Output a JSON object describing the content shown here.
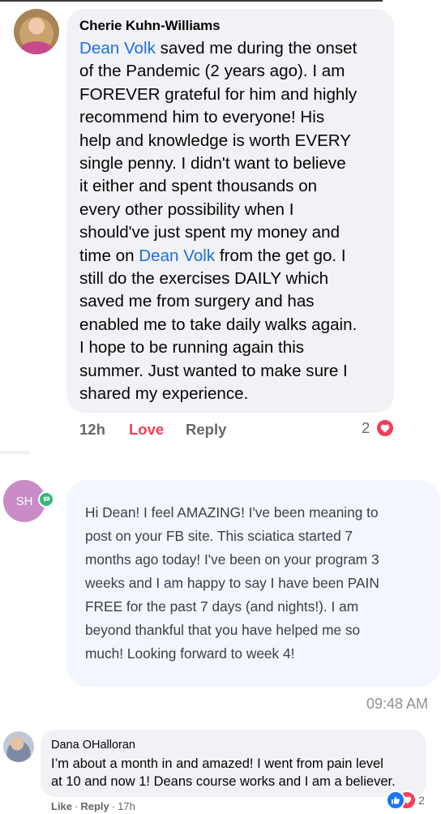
{
  "comment1": {
    "author": "Cherie Kuhn-Williams",
    "mention": "Dean Volk",
    "text_part1": " saved me during the onset\nof the Pandemic (2 years ago).  I am\nFOREVER grateful for him and highly\nrecommend him to everyone!  His\nhelp and knowledge is worth EVERY\nsingle penny.  I didn't want to believe\nit either and spent thousands on\nevery other possibility when I\nshould've just spent my money and\ntime on ",
    "mention2": "Dean Volk",
    "text_part2": " from the get go.  I\nstill do the exercises DAILY which\nsaved me from surgery and has\nenabled me to take daily walks again.\nI hope to be running again this\nsummer.  Just wanted to make sure I\nshared my experience.",
    "time": "12h",
    "reaction_label": "Love",
    "reply_label": "Reply",
    "reaction_count": "2",
    "reaction_icon": "heart-icon",
    "accent_color": "#f33e58"
  },
  "message2": {
    "avatar_initials": "SH",
    "badge_icon": "message-icon",
    "text": "Hi Dean!  I feel AMAZING!  I've been meaning to\npost on your FB site. This sciatica started 7\nmonths ago today!  I've been on your program 3\nweeks and I am happy to say I have been PAIN\nFREE for the past 7 days (and nights!). I am\nbeyond thankful that you have helped me so\nmuch!  Looking forward to week 4!",
    "time": "09:48 AM"
  },
  "comment3": {
    "author": "Dana OHalloran",
    "text": "I’m about a month in and amazed! I went from pain level\nat 10 and now 1! Deans course works and I am a believer.",
    "like_label": "Like",
    "reply_label": "Reply",
    "time": "17h",
    "reaction_count": "2",
    "reaction_icons": [
      "like-icon",
      "heart-icon"
    ]
  }
}
